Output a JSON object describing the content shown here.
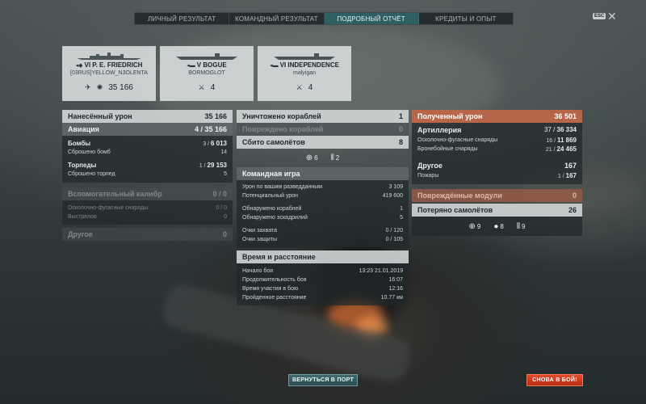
{
  "tabs": [
    {
      "label": "ЛИЧНЫЙ РЕЗУЛЬТАТ",
      "active": false
    },
    {
      "label": "КОМАНДНЫЙ РЕЗУЛЬТАТ",
      "active": false
    },
    {
      "label": "ПОДРОБНЫЙ ОТЧЁТ",
      "active": true
    },
    {
      "label": "КРЕДИТЫ И ОПЫТ",
      "active": false
    }
  ],
  "esc_label": "ESC",
  "close_glyph": "✕",
  "players": [
    {
      "ship": "VI P. E. FRIEDRICH",
      "player": "[03RUS]YELLOW_N3OLENTA",
      "stats": [
        {
          "icon": "plane-icon",
          "value": ""
        },
        {
          "icon": "burst-icon",
          "value": "35 166"
        }
      ]
    },
    {
      "ship": "V BOGUE",
      "player": "BORMOGLOT",
      "stats": [
        {
          "icon": "sword-icon",
          "value": "4"
        }
      ]
    },
    {
      "ship": "VI INDEPENDENCE",
      "player": "malyigan",
      "stats": [
        {
          "icon": "sword-icon",
          "value": "4"
        }
      ]
    }
  ],
  "left": {
    "damage": {
      "label": "Нанесённый урон",
      "value": "35 166"
    },
    "aviation": {
      "label": "Авиация",
      "value_a": "4",
      "value_b": "35 166"
    },
    "bombs": {
      "label": "Бомбы",
      "value_a": "3",
      "value_b": "6 013"
    },
    "bombs_dropped": {
      "label": "Сброшено бомб",
      "value": "14"
    },
    "torpedoes": {
      "label": "Торпеды",
      "value_a": "1",
      "value_b": "29 153"
    },
    "torpedoes_dropped": {
      "label": "Сброшено торпед",
      "value": "5"
    },
    "secondary": {
      "label": "Вспомогательный калибр",
      "value": "0 / 0"
    },
    "he_shells": {
      "label": "Осколочно-фугасные снаряды",
      "value": "0 / 0"
    },
    "shots": {
      "label": "Выстрелов",
      "value": "0"
    },
    "other": {
      "label": "Другое",
      "value": "0"
    }
  },
  "middle": {
    "destroyed": {
      "label": "Уничтожено кораблей",
      "value": "1"
    },
    "damaged": {
      "label": "Повреждено кораблей",
      "value": "0"
    },
    "planes_shot": {
      "label": "Сбито самолётов",
      "value": "8"
    },
    "plane_icons": [
      {
        "icon": "aa-icon",
        "value": "6"
      },
      {
        "icon": "squadron-icon",
        "value": "2"
      }
    ],
    "team_game": {
      "label": "Командная игра"
    },
    "spotting_damage": {
      "label": "Урон по вашим разведданным",
      "value": "3 109"
    },
    "potential_damage": {
      "label": "Потенциальный урон",
      "value": "419 600"
    },
    "ships_spotted": {
      "label": "Обнаружено кораблей",
      "value": "1"
    },
    "squadrons_spotted": {
      "label": "Обнаружено эскадрилий",
      "value": "5"
    },
    "capture_points": {
      "label": "Очки захвата",
      "value": "0 / 120"
    },
    "defense_points": {
      "label": "Очки защиты",
      "value": "0 / 105"
    },
    "time_distance": {
      "label": "Время и расстояние"
    },
    "battle_start": {
      "label": "Начало боя",
      "value": "13:23  21.01.2019"
    },
    "battle_duration": {
      "label": "Продолжительность боя",
      "value": "16:07"
    },
    "participation": {
      "label": "Время участия в бою",
      "value": "12:16"
    },
    "distance": {
      "label": "Пройденное расстояние",
      "value": "10.77 км"
    }
  },
  "right": {
    "received": {
      "label": "Полученный урон",
      "value": "36 501"
    },
    "artillery": {
      "label": "Артиллерия",
      "value_a": "37",
      "value_b": "36 334"
    },
    "he_shells": {
      "label": "Осколочно-фугасные снаряды",
      "value_a": "16",
      "value_b": "11 869"
    },
    "ap_shells": {
      "label": "Бронебойные снаряды",
      "value_a": "21",
      "value_b": "24 465"
    },
    "other": {
      "label": "Другое",
      "value": "167"
    },
    "fires": {
      "label": "Пожары",
      "value_a": "1",
      "value_b": "167"
    },
    "modules": {
      "label": "Повреждённые модули",
      "value": "0"
    },
    "planes_lost": {
      "label": "Потеряно самолётов",
      "value": "26"
    },
    "plane_icons": [
      {
        "icon": "aa-icon",
        "value": "9"
      },
      {
        "icon": "bomb-icon",
        "value": "8"
      },
      {
        "icon": "squadron-icon",
        "value": "9"
      }
    ]
  },
  "buttons": {
    "port": "ВЕРНУТЬСЯ В ПОРТ",
    "battle": "СНОВА В БОЙ!"
  },
  "colors": {
    "accent_tab": "#2d5f63",
    "received_header": "#bd6649",
    "battle_button": "#d23f22"
  }
}
